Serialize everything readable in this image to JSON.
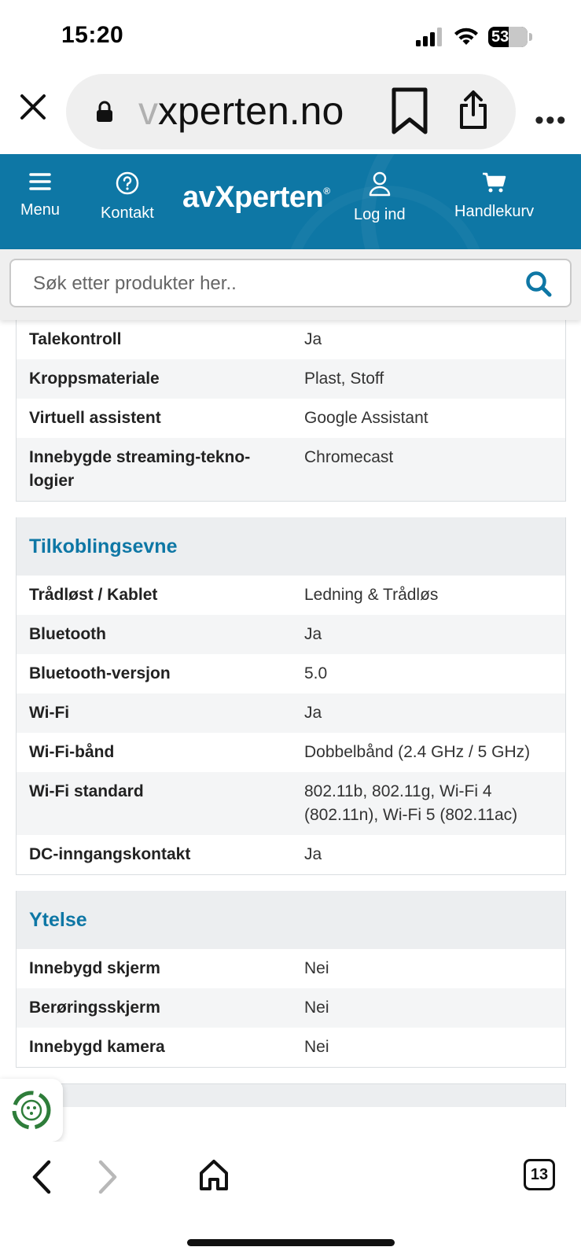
{
  "status_bar": {
    "time": "15:20",
    "battery": "53"
  },
  "browser": {
    "url_faded": "v",
    "url_main": "xperten.no"
  },
  "header": {
    "menu_label": "Menu",
    "contact_label": "Kontakt",
    "logo_text": "avXperten",
    "logo_mark": "®",
    "login_label": "Log ind",
    "cart_label": "Handlekurv"
  },
  "search": {
    "placeholder": "Søk etter produkter her.."
  },
  "spec_top": {
    "rows": [
      {
        "key": "Talekontroll",
        "value": "Ja"
      },
      {
        "key": "Kroppsmateriale",
        "value": "Plast, Stoff"
      },
      {
        "key": "Virtuell assistent",
        "value": "Google Assistant"
      },
      {
        "key": "Innebygde streaming-tekno-logier",
        "value": "Chromecast"
      }
    ]
  },
  "connectivity": {
    "title": "Tilkoblingsevne",
    "rows": [
      {
        "key": "Trådløst / Kablet",
        "value": "Ledning & Trådløs"
      },
      {
        "key": "Bluetooth",
        "value": "Ja"
      },
      {
        "key": "Bluetooth-versjon",
        "value": "5.0"
      },
      {
        "key": "Wi-Fi",
        "value": "Ja"
      },
      {
        "key": "Wi-Fi-bånd",
        "value": "Dobbelbånd (2.4 GHz / 5 GHz)"
      },
      {
        "key": "Wi-Fi standard",
        "value": "802.11b, 802.11g, Wi-Fi 4 (802.11n), Wi-Fi 5 (802.11ac)"
      },
      {
        "key": "DC-inngangskontakt",
        "value": "Ja"
      }
    ]
  },
  "performance": {
    "title": "Ytelse",
    "rows": [
      {
        "key": "Innebygd skjerm",
        "value": "Nei"
      },
      {
        "key": "Berøringsskjerm",
        "value": "Nei"
      },
      {
        "key": "Innebygd kamera",
        "value": "Nei"
      }
    ]
  },
  "toolbar": {
    "tab_count": "13"
  }
}
